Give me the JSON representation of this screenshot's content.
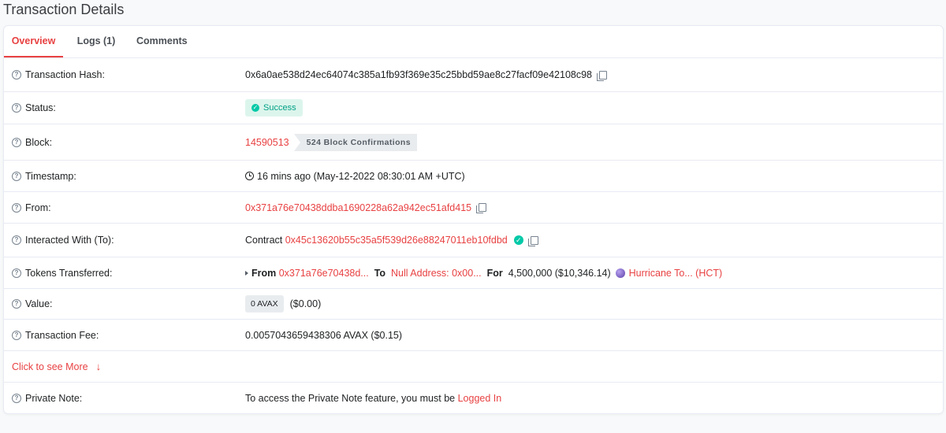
{
  "page_title": "Transaction Details",
  "tabs": [
    {
      "label": "Overview"
    },
    {
      "label": "Logs (1)"
    },
    {
      "label": "Comments"
    }
  ],
  "rows": {
    "hash": {
      "label": "Transaction Hash:",
      "value": "0x6a0ae538d24ec64074c385a1fb93f369e35c25bbd59ae8c27facf09e42108c98"
    },
    "status": {
      "label": "Status:",
      "value": "Success"
    },
    "block": {
      "label": "Block:",
      "value": "14590513",
      "confirmations": "524 Block Confirmations"
    },
    "timestamp": {
      "label": "Timestamp:",
      "value": "16 mins ago (May-12-2022 08:30:01 AM +UTC)"
    },
    "from": {
      "label": "From:",
      "value": "0x371a76e70438ddba1690228a62a942ec51afd415"
    },
    "to": {
      "label": "Interacted With (To):",
      "prefix": "Contract",
      "value": "0x45c13620b55c35a5f539d26e88247011eb10fdbd"
    },
    "tokens": {
      "label": "Tokens Transferred:",
      "from_label": "From",
      "from_value": "0x371a76e70438d...",
      "to_label": "To",
      "to_value": "Null Address: 0x00...",
      "for_label": "For",
      "amount": "4,500,000 ($10,346.14)",
      "token_name": "Hurricane To... (HCT)"
    },
    "value": {
      "label": "Value:",
      "badge": "0 AVAX",
      "usd": "($0.00)"
    },
    "fee": {
      "label": "Transaction Fee:",
      "value": "0.0057043659438306 AVAX ($0.15)"
    },
    "more": {
      "label": "Click to see More"
    },
    "note": {
      "label": "Private Note:",
      "text": "To access the Private Note feature, you must be",
      "link": "Logged In"
    }
  },
  "colors": {
    "accent": "#e84142",
    "success": "#00c9a7",
    "success_bg": "#dcf5ec"
  },
  "icons": [
    "question-circle-icon",
    "copy-icon",
    "check-circle-icon",
    "clock-icon",
    "verified-icon",
    "caret-right-icon",
    "token-icon",
    "arrow-down-icon"
  ]
}
